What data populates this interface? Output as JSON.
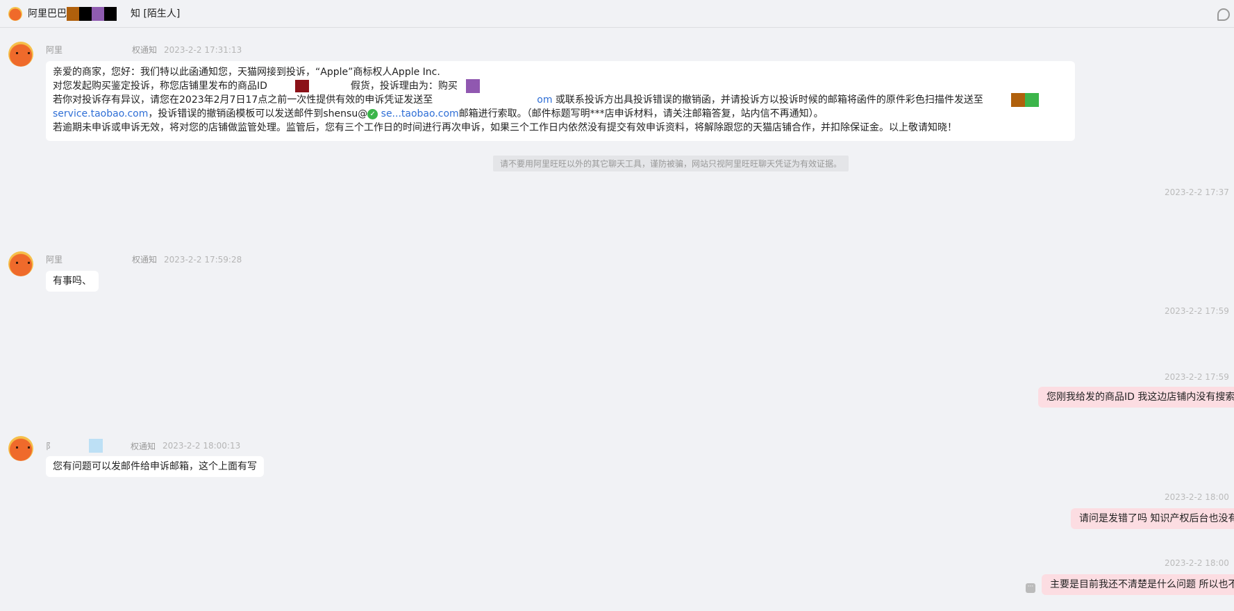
{
  "header": {
    "title_prefix": "阿里巴巴",
    "title_suffix": "知",
    "tag": "[陌生人]"
  },
  "messages_in": [
    {
      "name": "阿里",
      "role": "权通知",
      "time": "2023-2-2 17:31:13",
      "lines": [
        "亲爱的商家，您好：我们特以此函通知您，天猫网接到投诉，“Apple”商标权人Apple Inc.",
        " 对您发起购买鉴定投诉，称您店铺里发布的商品ID",
        "假货，投诉理由为：购买",
        "若你对投诉存有异议，请您在2023年2月7日17点之前一次性提供有效的申诉凭证发送至",
        "om",
        " 或联系投诉方出具投诉错误的撤销函，并请投诉方以投诉时候的邮箱将函件的原件彩色扫描件发送至",
        "service.taobao.com",
        "，投诉错误的撤销函模板可以发送邮件到shensu@",
        " se...taobao.com",
        "邮箱进行索取。（邮件标题写明***店申诉材料，请关注邮箱答复，站内信不再通知）。",
        "若逾期未申诉或申诉无效，将对您的店铺做监管处理。监管后，您有三个工作日的时间进行再次申诉，如果三个工作日内依然没有提交有效申诉资料，将解除跟您的天猫店铺合作，并扣除保证金。以上敬请知晓！"
      ]
    },
    {
      "name": "阿里",
      "role": "权通知",
      "time": "2023-2-2 17:59:28",
      "text": "有事吗、"
    },
    {
      "name": "阝",
      "role": "权通知",
      "time": "2023-2-2 18:00:13",
      "text": "您有问题可以发邮件给申诉邮箱，这个上面有写"
    }
  ],
  "notice": "请不要用阿里旺旺以外的其它聊天工具，谨防被骗，网站只视阿里旺旺聊天凭证为有效证据。",
  "messages_out": [
    {
      "time": "2023-2-2 17:37"
    },
    {
      "time": "2023-2-2 17:59"
    },
    {
      "time": "2023-2-2 17:59",
      "text": "您刚我给发的商品ID 我这边店铺内没有搜索到"
    },
    {
      "time": "2023-2-2 18:00",
      "text": "请问是发错了吗  知识产权后台也没有查"
    },
    {
      "time": "2023-2-2 18:00",
      "text": "主要是目前我还不清楚是什么问题  所以也不知"
    }
  ]
}
